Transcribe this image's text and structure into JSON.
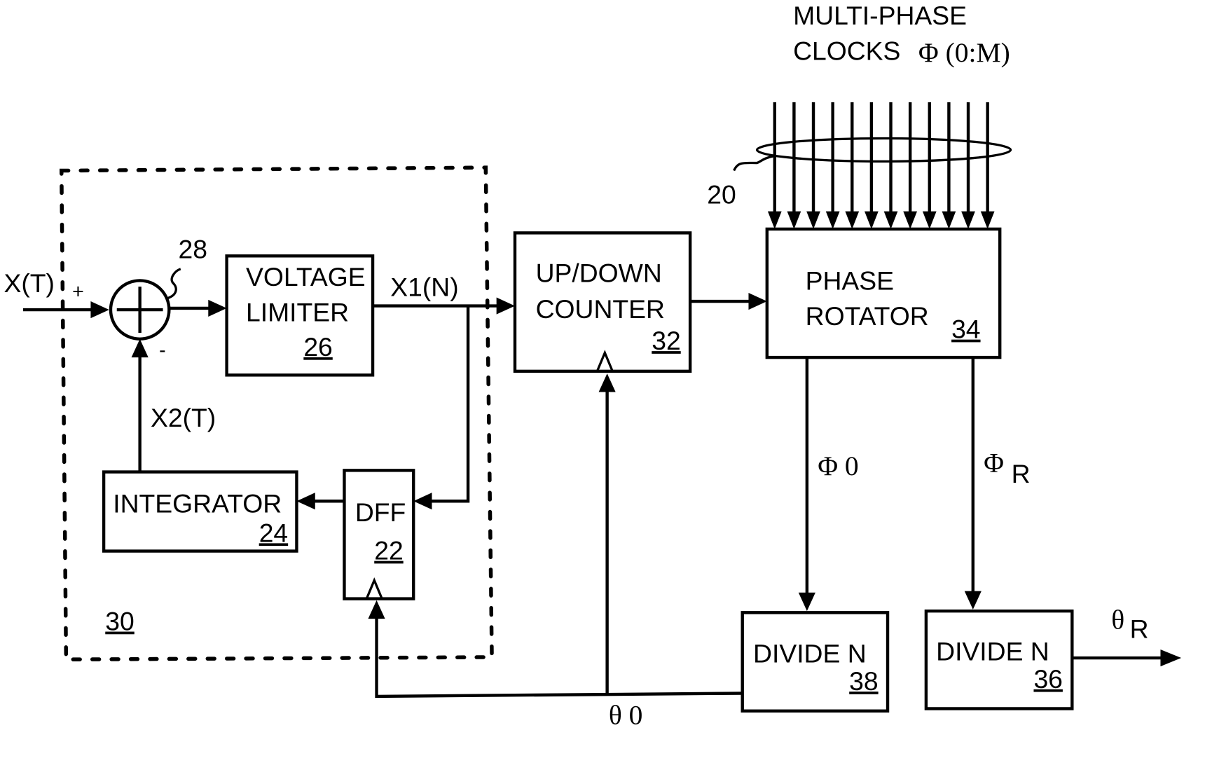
{
  "header": {
    "title_line1": "MULTI-PHASE",
    "title_line2": "CLOCKS",
    "clock_symbol": "Φ (0:M)"
  },
  "refs": {
    "clock_bus": "20",
    "loop_filter_group": "30",
    "adder": "28"
  },
  "clock_lines_count": 12,
  "blocks": {
    "voltage_limiter": {
      "line1": "VOLTAGE",
      "line2": "LIMITER",
      "num": "26"
    },
    "integrator": {
      "line1": "INTEGRATOR",
      "num": "24"
    },
    "dff": {
      "line1": "DFF",
      "num": "22"
    },
    "counter": {
      "line1": "UP/DOWN",
      "line2": "COUNTER",
      "num": "32"
    },
    "phase_rotator": {
      "line1": "PHASE",
      "line2": "ROTATOR",
      "num": "34"
    },
    "divide_38": {
      "line1": "DIVIDE N",
      "num": "38"
    },
    "divide_36": {
      "line1": "DIVIDE N",
      "num": "36"
    }
  },
  "signals": {
    "input": "X(T)",
    "plus": "+",
    "minus": "-",
    "x1": "X1(N)",
    "x2": "X2(T)",
    "phi0": "Φ 0",
    "phiR_main": "Φ",
    "phiR_sub": "R",
    "theta0": "θ 0",
    "thetaR_main": "θ",
    "thetaR_sub": "R"
  }
}
